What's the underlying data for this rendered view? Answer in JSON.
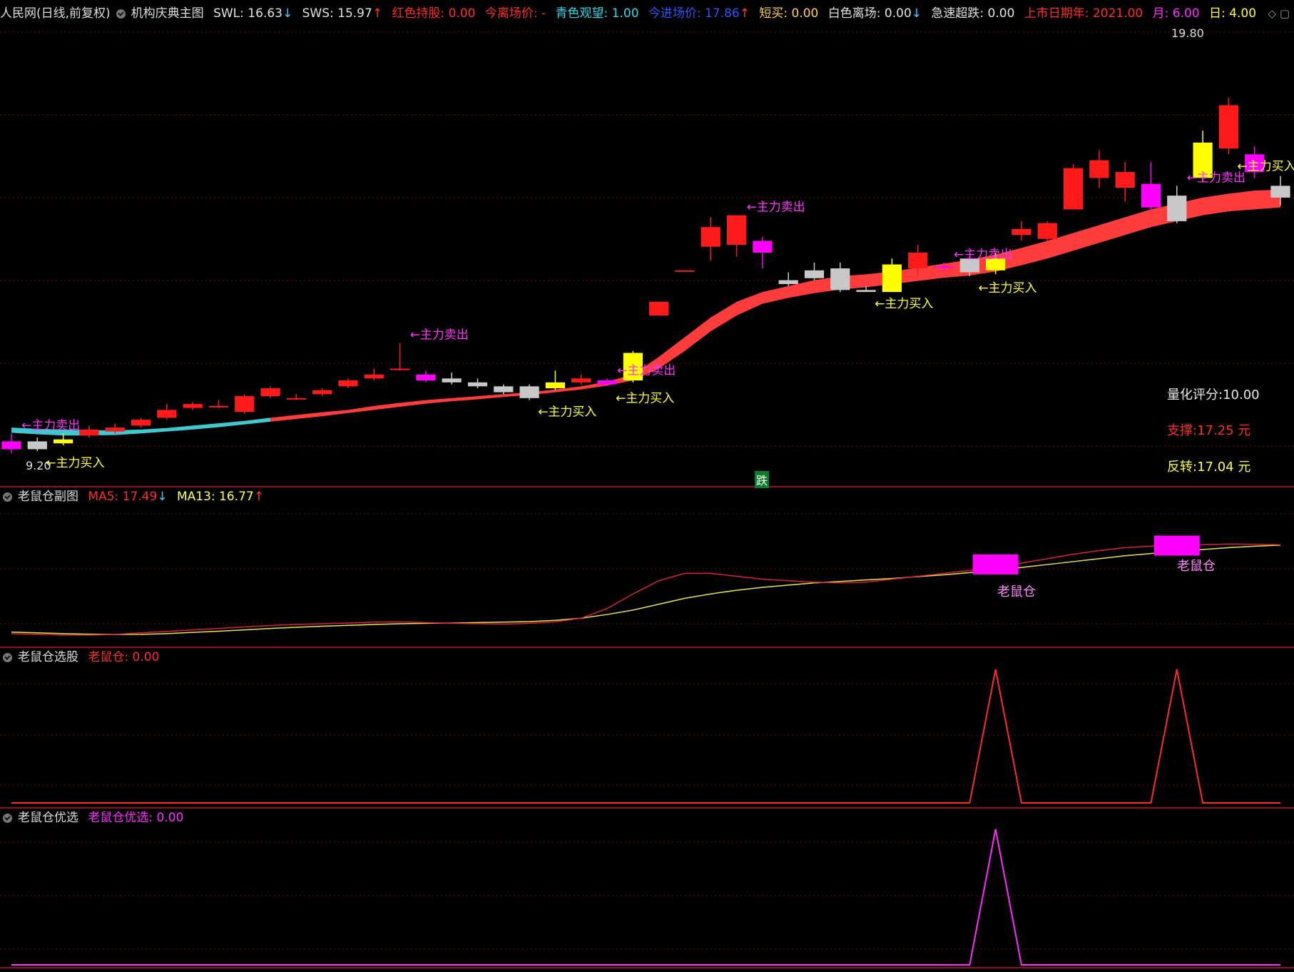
{
  "header": {
    "stock": "人民网(日线,前复权)",
    "indicator": "机构庆典主图",
    "swl": "SWL: 16.63",
    "sws": "SWS: 15.97",
    "hongse": "红色持股: 0.00",
    "jinli": "今离场价: -",
    "qingse": "青色观望: 1.00",
    "jinjin": "今进场价: 17.86",
    "duanmai": "短买: 0.00",
    "baise": "白色离场: 0.00",
    "jisu": "急速超跌: 0.00",
    "shangshi": "上市日期年: 2021.00",
    "yue": "月: 6.00",
    "ri": "日: 4.00"
  },
  "main_info": {
    "score": "量化评分:10.00",
    "support": "支撑:17.25 元",
    "reversal": "反转:17.04 元",
    "high_label": "19.80",
    "low_label": "9.20",
    "die": "跌"
  },
  "panel2": {
    "title": "老鼠仓副图",
    "ma5": "MA5: 17.49",
    "ma13": "MA13: 16.77",
    "label": "老鼠仓"
  },
  "panel3": {
    "title": "老鼠仓选股",
    "value": "老鼠仓: 0.00"
  },
  "panel4": {
    "title": "老鼠仓优选",
    "value": "老鼠仓优选: 0.00"
  },
  "annotations": {
    "buy": "←主力买入",
    "sell": "←主力卖出"
  },
  "colors": {
    "up": "#ff1a1a",
    "white": "#c8c8c8",
    "yellow": "#ffff00",
    "magenta": "#ff00ff",
    "cyan": "#40c8d0",
    "band": "#ff3c3c"
  },
  "chart_data": {
    "type": "candlestick",
    "candles": [
      {
        "o": 9.4,
        "c": 9.2,
        "h": 9.6,
        "l": 9.1,
        "k": "magenta"
      },
      {
        "o": 9.4,
        "c": 9.2,
        "h": 9.5,
        "l": 9.15,
        "k": "white"
      },
      {
        "o": 9.45,
        "c": 9.35,
        "h": 9.6,
        "l": 9.3,
        "k": "yellow"
      },
      {
        "o": 9.55,
        "c": 9.7,
        "h": 9.8,
        "l": 9.5,
        "k": "up"
      },
      {
        "o": 9.65,
        "c": 9.75,
        "h": 9.85,
        "l": 9.6,
        "k": "up"
      },
      {
        "o": 9.8,
        "c": 9.95,
        "h": 10.0,
        "l": 9.75,
        "k": "up"
      },
      {
        "o": 10.0,
        "c": 10.2,
        "h": 10.35,
        "l": 9.95,
        "k": "up"
      },
      {
        "o": 10.25,
        "c": 10.35,
        "h": 10.4,
        "l": 10.2,
        "k": "up"
      },
      {
        "o": 10.3,
        "c": 10.3,
        "h": 10.45,
        "l": 10.25,
        "k": "up"
      },
      {
        "o": 10.15,
        "c": 10.55,
        "h": 10.6,
        "l": 10.1,
        "k": "up"
      },
      {
        "o": 10.55,
        "c": 10.75,
        "h": 10.8,
        "l": 10.5,
        "k": "up"
      },
      {
        "o": 10.5,
        "c": 10.5,
        "h": 10.6,
        "l": 10.45,
        "k": "up"
      },
      {
        "o": 10.6,
        "c": 10.7,
        "h": 10.75,
        "l": 10.55,
        "k": "up"
      },
      {
        "o": 10.8,
        "c": 10.95,
        "h": 11.0,
        "l": 10.75,
        "k": "up"
      },
      {
        "o": 11.0,
        "c": 11.1,
        "h": 11.25,
        "l": 10.95,
        "k": "up"
      },
      {
        "o": 11.25,
        "c": 11.25,
        "h": 11.9,
        "l": 11.2,
        "k": "up"
      },
      {
        "o": 11.1,
        "c": 10.95,
        "h": 11.2,
        "l": 10.9,
        "k": "magenta"
      },
      {
        "o": 11.0,
        "c": 10.9,
        "h": 11.15,
        "l": 10.85,
        "k": "white"
      },
      {
        "o": 10.9,
        "c": 10.8,
        "h": 11.0,
        "l": 10.75,
        "k": "white"
      },
      {
        "o": 10.8,
        "c": 10.65,
        "h": 10.85,
        "l": 10.6,
        "k": "white"
      },
      {
        "o": 10.8,
        "c": 10.5,
        "h": 10.85,
        "l": 10.45,
        "k": "white"
      },
      {
        "o": 10.75,
        "c": 10.9,
        "h": 11.2,
        "l": 10.7,
        "k": "yellow"
      },
      {
        "o": 10.9,
        "c": 11.0,
        "h": 11.1,
        "l": 10.85,
        "k": "up"
      },
      {
        "o": 10.95,
        "c": 10.85,
        "h": 11.0,
        "l": 10.8,
        "k": "magenta"
      },
      {
        "o": 10.95,
        "c": 11.65,
        "h": 11.7,
        "l": 10.9,
        "k": "yellow"
      },
      {
        "o": 12.6,
        "c": 12.95,
        "h": 12.95,
        "l": 12.6,
        "k": "up"
      },
      {
        "o": 13.75,
        "c": 13.75,
        "h": 13.75,
        "l": 13.75,
        "k": "up"
      },
      {
        "o": 14.35,
        "c": 14.85,
        "h": 15.1,
        "l": 14.0,
        "k": "up"
      },
      {
        "o": 14.4,
        "c": 15.15,
        "h": 15.15,
        "l": 14.1,
        "k": "up"
      },
      {
        "o": 14.5,
        "c": 14.2,
        "h": 14.6,
        "l": 13.8,
        "k": "magenta"
      },
      {
        "o": 13.4,
        "c": 13.5,
        "h": 13.7,
        "l": 13.35,
        "k": "white"
      },
      {
        "o": 13.75,
        "c": 13.55,
        "h": 13.95,
        "l": 13.5,
        "k": "white"
      },
      {
        "o": 13.8,
        "c": 13.25,
        "h": 13.95,
        "l": 13.2,
        "k": "white"
      },
      {
        "o": 13.25,
        "c": 13.2,
        "h": 13.35,
        "l": 13.2,
        "k": "white"
      },
      {
        "o": 13.2,
        "c": 13.9,
        "h": 14.05,
        "l": 13.2,
        "k": "yellow"
      },
      {
        "o": 13.8,
        "c": 14.2,
        "h": 14.4,
        "l": 13.6,
        "k": "up"
      },
      {
        "o": 13.85,
        "c": 13.85,
        "h": 13.95,
        "l": 13.7,
        "k": "magenta"
      },
      {
        "o": 14.05,
        "c": 13.7,
        "h": 14.1,
        "l": 13.6,
        "k": "white"
      },
      {
        "o": 14.05,
        "c": 13.75,
        "h": 14.2,
        "l": 13.65,
        "k": "yellow"
      },
      {
        "o": 14.65,
        "c": 14.8,
        "h": 15.0,
        "l": 14.5,
        "k": "up"
      },
      {
        "o": 14.55,
        "c": 14.95,
        "h": 15.0,
        "l": 14.5,
        "k": "up"
      },
      {
        "o": 15.3,
        "c": 16.35,
        "h": 16.45,
        "l": 15.3,
        "k": "up"
      },
      {
        "o": 16.1,
        "c": 16.55,
        "h": 16.8,
        "l": 15.85,
        "k": "up"
      },
      {
        "o": 15.85,
        "c": 16.25,
        "h": 16.5,
        "l": 15.5,
        "k": "up"
      },
      {
        "o": 15.95,
        "c": 15.35,
        "h": 16.5,
        "l": 15.25,
        "k": "magenta"
      },
      {
        "o": 15.65,
        "c": 15.0,
        "h": 15.9,
        "l": 14.95,
        "k": "white"
      },
      {
        "o": 16.1,
        "c": 17.0,
        "h": 17.3,
        "l": 16.0,
        "k": "yellow"
      },
      {
        "o": 16.85,
        "c": 17.95,
        "h": 18.15,
        "l": 16.7,
        "k": "up"
      },
      {
        "o": 16.7,
        "c": 16.25,
        "h": 16.9,
        "l": 16.1,
        "k": "magenta"
      },
      {
        "o": 15.9,
        "c": 15.6,
        "h": 16.15,
        "l": 15.4,
        "k": "white"
      }
    ],
    "band_upper": [
      9.75,
      9.72,
      9.7,
      9.68,
      9.68,
      9.7,
      9.74,
      9.8,
      9.86,
      9.92,
      10.0,
      10.07,
      10.14,
      10.2,
      10.3,
      10.38,
      10.45,
      10.5,
      10.55,
      10.6,
      10.65,
      10.72,
      10.8,
      10.92,
      11.1,
      11.55,
      12.05,
      12.55,
      12.95,
      13.2,
      13.35,
      13.5,
      13.6,
      13.65,
      13.72,
      13.82,
      13.92,
      14.02,
      14.15,
      14.32,
      14.5,
      14.7,
      14.9,
      15.1,
      15.3,
      15.45,
      15.6,
      15.7,
      15.78,
      15.8
    ],
    "band_lower": [
      9.62,
      9.58,
      9.55,
      9.55,
      9.56,
      9.6,
      9.65,
      9.7,
      9.76,
      9.83,
      9.9,
      9.97,
      10.04,
      10.12,
      10.2,
      10.28,
      10.36,
      10.42,
      10.47,
      10.53,
      10.58,
      10.65,
      10.72,
      10.82,
      10.95,
      11.25,
      11.7,
      12.2,
      12.6,
      12.9,
      13.05,
      13.17,
      13.26,
      13.32,
      13.4,
      13.48,
      13.56,
      13.62,
      13.72,
      13.88,
      14.05,
      14.25,
      14.45,
      14.65,
      14.85,
      15.0,
      15.15,
      15.25,
      15.3,
      15.35
    ],
    "ma5": [
      9.5,
      9.45,
      9.4,
      9.4,
      9.45,
      9.55,
      9.65,
      9.75,
      9.85,
      9.95,
      10.05,
      10.12,
      10.18,
      10.22,
      10.28,
      10.3,
      10.25,
      10.2,
      10.18,
      10.15,
      10.2,
      10.3,
      10.55,
      11.2,
      12.2,
      13.1,
      13.6,
      13.6,
      13.4,
      13.2,
      13.1,
      13.0,
      12.95,
      13.0,
      13.2,
      13.4,
      13.6,
      13.8,
      14.0,
      14.3,
      14.6,
      14.9,
      15.15,
      15.35,
      15.45,
      15.5,
      15.55,
      15.6,
      15.58,
      15.55
    ],
    "ma13": [
      9.6,
      9.55,
      9.5,
      9.46,
      9.44,
      9.45,
      9.5,
      9.58,
      9.66,
      9.75,
      9.85,
      9.93,
      10.0,
      10.06,
      10.12,
      10.17,
      10.2,
      10.22,
      10.25,
      10.28,
      10.32,
      10.4,
      10.55,
      10.8,
      11.1,
      11.5,
      11.9,
      12.2,
      12.45,
      12.65,
      12.8,
      12.95,
      13.05,
      13.15,
      13.25,
      13.38,
      13.5,
      13.65,
      13.82,
      14.0,
      14.2,
      14.4,
      14.6,
      14.8,
      14.95,
      15.1,
      15.22,
      15.35,
      15.45,
      15.52
    ],
    "laoshucang": [
      0,
      0,
      0,
      0,
      0,
      0,
      0,
      0,
      0,
      0,
      0,
      0,
      0,
      0,
      0,
      0,
      0,
      0,
      0,
      0,
      0,
      0,
      0,
      0,
      0,
      0,
      0,
      0,
      0,
      0,
      0,
      0,
      0,
      0,
      0,
      0,
      0,
      0,
      1,
      0,
      0,
      0,
      0,
      0,
      0,
      1,
      0,
      0,
      0,
      0
    ],
    "laoshucang_youxuan": [
      0,
      0,
      0,
      0,
      0,
      0,
      0,
      0,
      0,
      0,
      0,
      0,
      0,
      0,
      0,
      0,
      0,
      0,
      0,
      0,
      0,
      0,
      0,
      0,
      0,
      0,
      0,
      0,
      0,
      0,
      0,
      0,
      0,
      0,
      0,
      0,
      0,
      0,
      1,
      0,
      0,
      0,
      0,
      0,
      0,
      0,
      0,
      0,
      0,
      0
    ],
    "buy_idx": [
      1,
      20,
      23,
      33,
      37,
      47
    ],
    "sell_idx": [
      0,
      15,
      23,
      28,
      36,
      45
    ],
    "ylim_main": [
      8.9,
      19.9
    ]
  }
}
